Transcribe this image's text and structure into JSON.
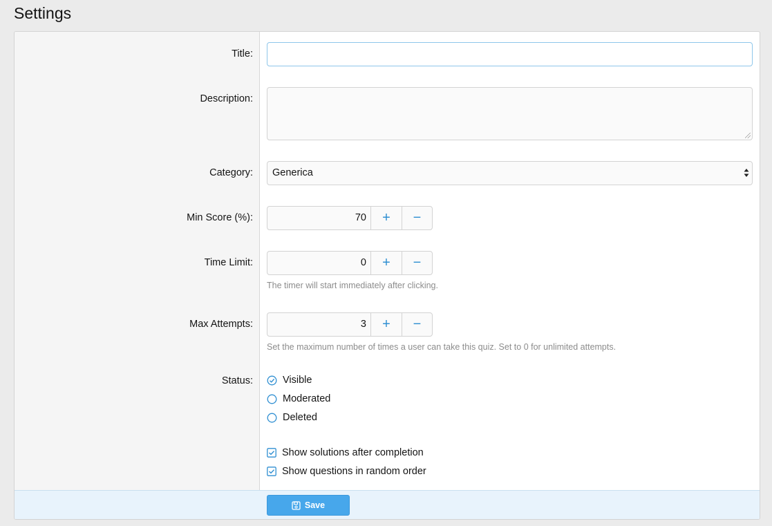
{
  "page": {
    "title": "Settings"
  },
  "form": {
    "title": {
      "label": "Title:",
      "value": ""
    },
    "description": {
      "label": "Description:",
      "value": ""
    },
    "category": {
      "label": "Category:",
      "value": "Generica"
    },
    "min_score": {
      "label": "Min Score (%):",
      "value": "70",
      "plus": "+",
      "minus": "−"
    },
    "time_limit": {
      "label": "Time Limit:",
      "value": "0",
      "plus": "+",
      "minus": "−",
      "hint": "The timer will start immediately after clicking."
    },
    "max_attempts": {
      "label": "Max Attempts:",
      "value": "3",
      "plus": "+",
      "minus": "−",
      "hint": "Set the maximum number of times a user can take this quiz. Set to 0 for unlimited attempts."
    },
    "status": {
      "label": "Status:",
      "options": [
        {
          "label": "Visible",
          "selected": true
        },
        {
          "label": "Moderated",
          "selected": false
        },
        {
          "label": "Deleted",
          "selected": false
        }
      ]
    },
    "checkboxes": [
      {
        "label": "Show solutions after completion",
        "checked": true
      },
      {
        "label": "Show questions in random order",
        "checked": true
      }
    ]
  },
  "footer": {
    "save_label": "Save"
  },
  "colors": {
    "accent": "#47a7eb",
    "icon": "#2f8fd2",
    "footer_bg": "#e8f3fc"
  }
}
